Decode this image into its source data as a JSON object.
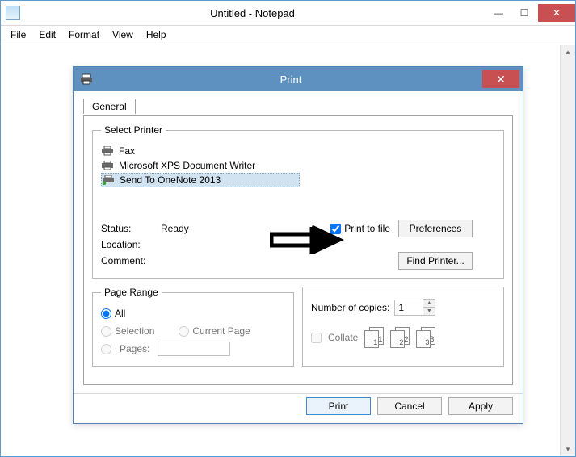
{
  "window": {
    "title": "Untitled - Notepad",
    "menus": [
      "File",
      "Edit",
      "Format",
      "View",
      "Help"
    ]
  },
  "dialog": {
    "title": "Print",
    "tab": "General",
    "select_printer_legend": "Select Printer",
    "printers": [
      {
        "name": "Fax",
        "selected": false
      },
      {
        "name": "Microsoft XPS Document Writer",
        "selected": false
      },
      {
        "name": "Send To OneNote 2013",
        "selected": true
      }
    ],
    "status_label": "Status:",
    "status_value": "Ready",
    "location_label": "Location:",
    "comment_label": "Comment:",
    "print_to_file_label": "Print to file",
    "print_to_file_checked": true,
    "preferences_button": "Preferences",
    "find_printer_button": "Find Printer...",
    "page_range_legend": "Page Range",
    "radio_all": "All",
    "radio_selection": "Selection",
    "radio_current": "Current Page",
    "radio_pages": "Pages:",
    "copies_label": "Number of copies:",
    "copies_value": "1",
    "collate_label": "Collate",
    "collate_checked": false,
    "stack_labels": [
      "1",
      "2",
      "3"
    ],
    "footer": {
      "print": "Print",
      "cancel": "Cancel",
      "apply": "Apply"
    }
  }
}
